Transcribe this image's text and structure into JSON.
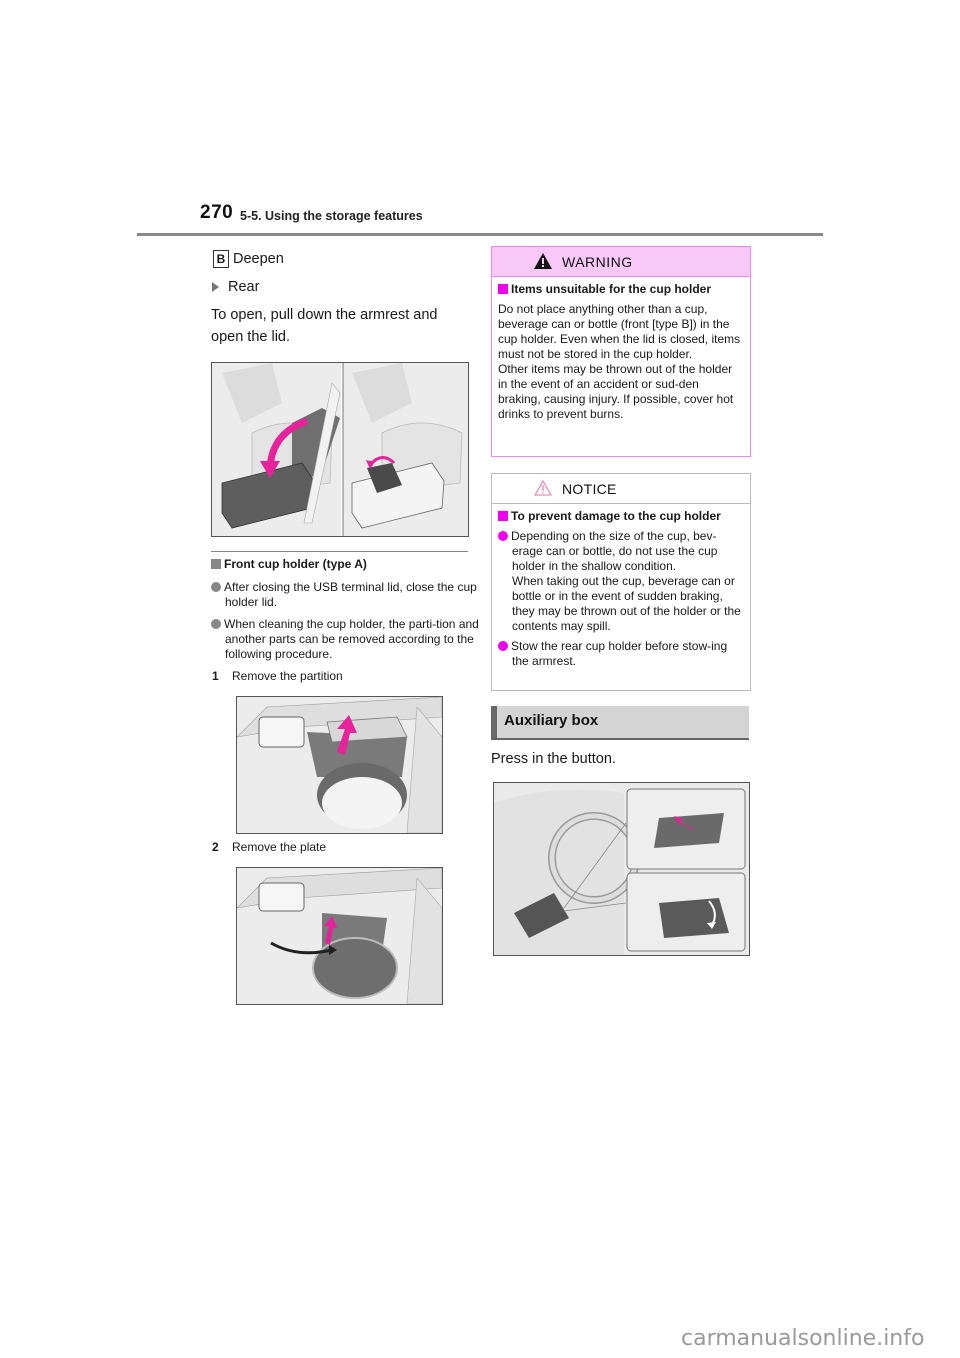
{
  "header": {
    "page_number": "270",
    "section_title": "5-5. Using the storage features"
  },
  "left": {
    "label_b": "B",
    "deepen": "Deepen",
    "rear": "Rear",
    "open_instruction": "To open, pull down the armrest and open the lid.",
    "figure_armrest": "rear-armrest-cup-holder-illustration",
    "front_cup": {
      "heading": "Front cup holder (type A)",
      "bullets": [
        "After closing the USB terminal lid, close the cup holder lid.",
        "When cleaning the cup holder, the parti-tion and another parts can be removed according to the following procedure."
      ],
      "steps": [
        {
          "num": "1",
          "text": "Remove the partition"
        },
        {
          "num": "2",
          "text": "Remove the plate"
        }
      ]
    }
  },
  "warning": {
    "title": "WARNING",
    "heading": "Items unsuitable for the cup holder",
    "body": "Do not place anything other than a cup, beverage can or bottle (front [type B]) in the cup holder. Even when the lid is closed, items must not be stored in the cup holder.",
    "body2": "Other items may be thrown out of the holder in the event of an accident or sud-den braking, causing injury. If possible, cover hot drinks to prevent burns."
  },
  "notice": {
    "title": "NOTICE",
    "heading": "To prevent damage to the cup holder",
    "bullets": [
      "Depending on the size of the cup, bev-erage can or bottle, do not use the cup holder in the shallow condition.",
      "Stow the rear cup holder before stow-ing the armrest."
    ],
    "bullet1_cont": "When taking out the cup, beverage can or bottle or in the event of sudden braking, they may be thrown out of the holder or the contents may spill."
  },
  "aux": {
    "title": "Auxiliary box",
    "instruction": "Press in the button."
  },
  "colors": {
    "accent_magenta": "#ee00ee",
    "warning_bg": "#f8c8f8",
    "notice_icon": "#f08fb8",
    "section_bar": "#6a6a6a",
    "heading_bg": "#d4d4d4"
  },
  "watermark": "carmanualsonline.info"
}
